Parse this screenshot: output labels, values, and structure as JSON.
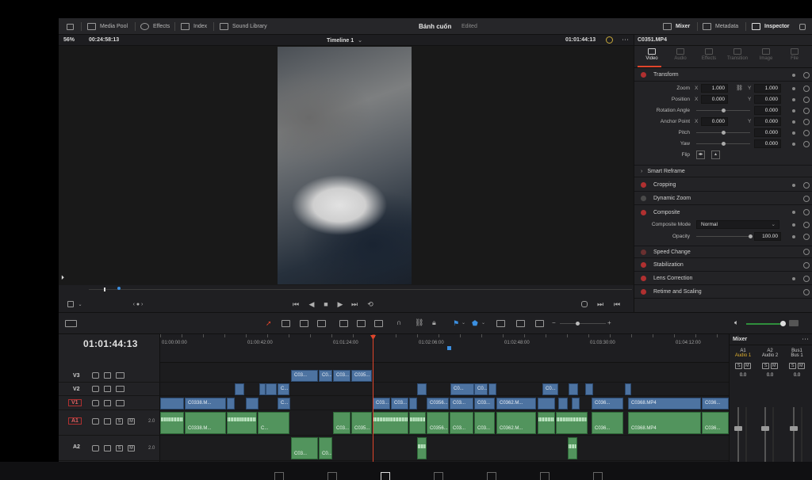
{
  "toolbar": {
    "media_pool": "Media Pool",
    "effects": "Effects",
    "index": "Index",
    "sound_library": "Sound Library",
    "project_title": "Bánh cuốn",
    "project_status": "Edited",
    "mixer": "Mixer",
    "metadata": "Metadata",
    "inspector": "Inspector"
  },
  "viewer": {
    "zoom": "56%",
    "source_timecode": "00:24:58:13",
    "timeline_name": "Timeline 1",
    "record_timecode": "01:01:44:13"
  },
  "inspector": {
    "clip_name": "C0351.MP4",
    "tabs": [
      "Video",
      "Audio",
      "Effects",
      "Transition",
      "Image",
      "File"
    ],
    "transform_title": "Transform",
    "zoom_label": "Zoom",
    "zoom_x": "1.000",
    "zoom_y": "1.000",
    "position_label": "Position",
    "position_x": "0.000",
    "position_y": "0.000",
    "rotation_label": "Rotation Angle",
    "rotation_value": "0.000",
    "anchor_label": "Anchor Point",
    "anchor_x": "0.000",
    "anchor_y": "0.000",
    "pitch_label": "Pitch",
    "pitch_value": "0.000",
    "yaw_label": "Yaw",
    "yaw_value": "0.000",
    "flip_label": "Flip",
    "x_axis": "X",
    "y_axis": "Y",
    "smart_reframe": "Smart Reframe",
    "cropping": "Cropping",
    "dynamic_zoom": "Dynamic Zoom",
    "composite": "Composite",
    "composite_mode_label": "Composite Mode",
    "composite_mode_value": "Normal",
    "opacity_label": "Opacity",
    "opacity_value": "100.00",
    "speed_change": "Speed Change",
    "stabilization": "Stabilization",
    "lens_correction": "Lens Correction",
    "retime_scaling": "Retime and Scaling"
  },
  "timeline": {
    "timecode": "01:01:44:13",
    "ruler": [
      "01:00:00:00",
      "01:00:42:00",
      "01:01:24:00",
      "01:02:06:00",
      "01:02:48:00",
      "01:03:30:00",
      "01:04:12:00"
    ],
    "tracks": {
      "v3": "V3",
      "v2": "V2",
      "v1": "V1",
      "a1": "A1",
      "a2": "A2",
      "a1_vol": "2.0",
      "a2_vol": "2.0",
      "solo": "S",
      "mute": "M"
    },
    "clips": {
      "v3_a": "C03...",
      "v3_b": "C0...",
      "v3_c": "C03...",
      "v3_d": "C035...",
      "v2_a": "C...",
      "v2_b": "C0...",
      "v2_c": "C0...",
      "v2_d": "C0...",
      "v1_a": "C0338.M...",
      "v1_b": "C...",
      "v1_c": "C03...",
      "v1_d": "C03...",
      "v1_e": "C0356...",
      "v1_f": "C03...",
      "v1_g": "C03...",
      "v1_h": "C0362.M...",
      "v1_i": "C036...",
      "v1_j": "C0368.MP4",
      "v1_k": "C036...",
      "a1_a": "C0338.M...",
      "a1_b": "C...",
      "a1_c": "C03...",
      "a1_d": "C035...",
      "a1_e": "C0356...",
      "a1_f": "C03...",
      "a1_g": "C03...",
      "a1_h": "C0362.M...",
      "a1_i": "C036...",
      "a1_j": "C0368.MP4",
      "a1_k": "C036...",
      "a2_a": "C03...",
      "a2_b": "C0..."
    }
  },
  "mixer": {
    "title": "Mixer",
    "channels": [
      {
        "id": "A1",
        "name": "Audio 1",
        "level": "0.0"
      },
      {
        "id": "A2",
        "name": "Audio 2",
        "level": "0.0"
      },
      {
        "id": "Bus1",
        "name": "Bus 1",
        "level": "0.0"
      }
    ],
    "solo": "S",
    "mute": "M"
  },
  "colors": {
    "accent_red": "#e0452b",
    "video_clip": "#4d73a1",
    "audio_clip": "#52945d",
    "audio1_label": "#e0b030"
  }
}
